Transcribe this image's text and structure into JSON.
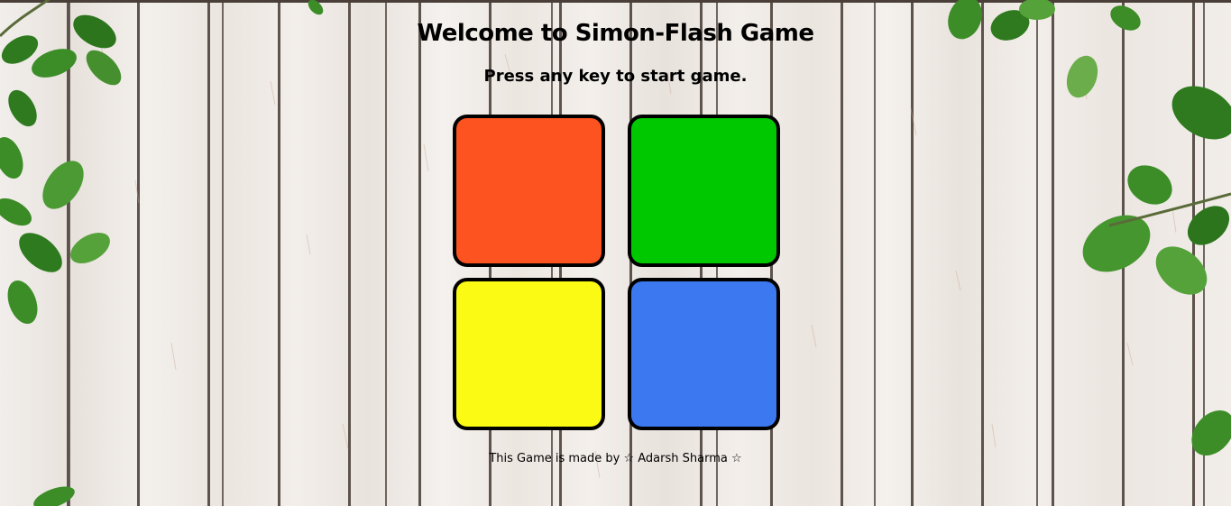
{
  "game": {
    "title": "Welcome to Simon-Flash Game",
    "instruction": "Press any key to start game.",
    "footer": "This Game is made by ☆ Adarsh Sharma ☆"
  },
  "pads": [
    {
      "name": "red",
      "color": "#fc5320"
    },
    {
      "name": "green",
      "color": "#00c800"
    },
    {
      "name": "yellow",
      "color": "#fafa14"
    },
    {
      "name": "blue",
      "color": "#3c78f0"
    }
  ],
  "theme": {
    "background": "wooden-planks",
    "decoration": "green-leaves"
  }
}
